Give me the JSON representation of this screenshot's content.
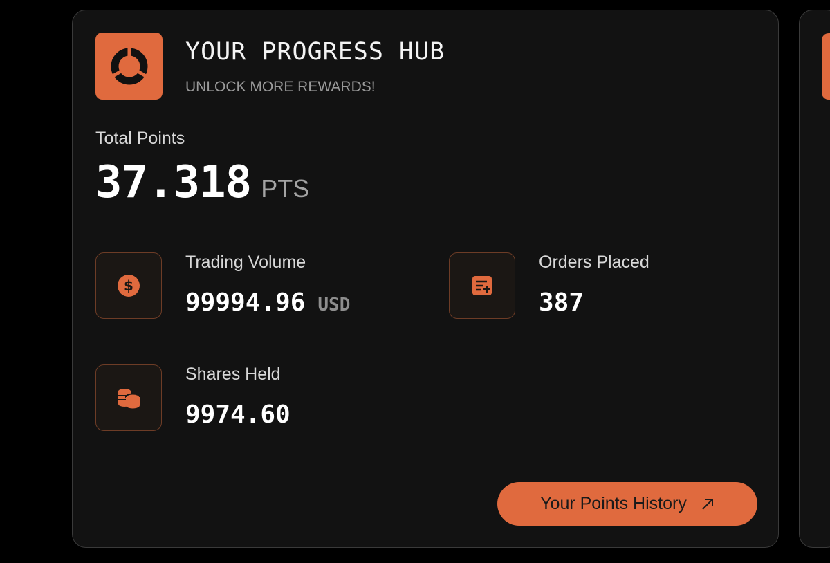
{
  "colors": {
    "accent": "#E06A3E",
    "background": "#000000",
    "card": "#121212",
    "border": "#3A3A3A",
    "muted": "#9A9A9A"
  },
  "hub": {
    "logo_icon": "progress-ring-icon",
    "title": "YOUR PROGRESS HUB",
    "subtitle": "UNLOCK MORE REWARDS!"
  },
  "total": {
    "label": "Total Points",
    "value": "37.318",
    "unit": "PTS"
  },
  "stats": {
    "trading_volume": {
      "icon": "dollar-coin-icon",
      "label": "Trading Volume",
      "value": "99994.96",
      "unit": "USD"
    },
    "orders_placed": {
      "icon": "list-add-icon",
      "label": "Orders Placed",
      "value": "387"
    },
    "shares_held": {
      "icon": "coin-stack-icon",
      "label": "Shares Held",
      "value": "9974.60"
    }
  },
  "history_button": {
    "label": "Your Points History",
    "icon": "arrow-up-right-icon"
  }
}
